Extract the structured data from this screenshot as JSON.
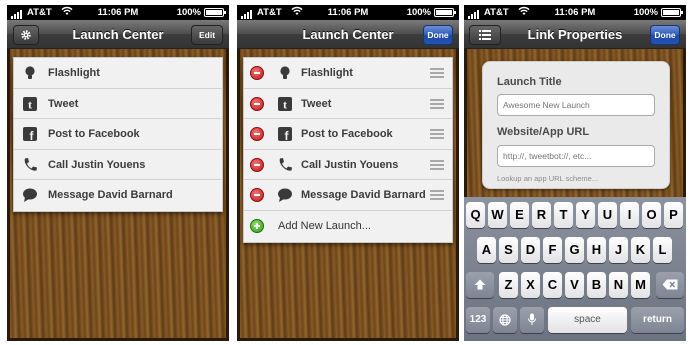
{
  "status": {
    "carrier": "AT&T",
    "time": "11:06 PM",
    "battery": "100%"
  },
  "screen1": {
    "title": "Launch Center",
    "left_button_icon": "gear-icon",
    "right_button": "Edit",
    "items": [
      {
        "label": "Flashlight",
        "icon": "lightbulb-icon"
      },
      {
        "label": "Tweet",
        "icon": "twitter-icon"
      },
      {
        "label": "Post to Facebook",
        "icon": "facebook-icon"
      },
      {
        "label": "Call Justin Youens",
        "icon": "phone-icon"
      },
      {
        "label": "Message David Barnard",
        "icon": "speech-bubble-icon"
      }
    ]
  },
  "screen2": {
    "title": "Launch Center",
    "right_button": "Done",
    "items": [
      {
        "label": "Flashlight",
        "icon": "lightbulb-icon"
      },
      {
        "label": "Tweet",
        "icon": "twitter-icon"
      },
      {
        "label": "Post to Facebook",
        "icon": "facebook-icon"
      },
      {
        "label": "Call Justin Youens",
        "icon": "phone-icon"
      },
      {
        "label": "Message David Barnard",
        "icon": "speech-bubble-icon"
      }
    ],
    "add_label": "Add New Launch..."
  },
  "screen3": {
    "title": "Link Properties",
    "left_button_icon": "list-icon",
    "right_button": "Done",
    "launch_title_label": "Launch Title",
    "launch_title_placeholder": "Awesome New Launch",
    "url_label": "Website/App URL",
    "url_placeholder": "http://, tweetbot://, etc...",
    "hint": "Lookup an app URL scheme...",
    "keyboard": {
      "row1": [
        "Q",
        "W",
        "E",
        "R",
        "T",
        "Y",
        "U",
        "I",
        "O",
        "P"
      ],
      "row2": [
        "A",
        "S",
        "D",
        "F",
        "G",
        "H",
        "J",
        "K",
        "L"
      ],
      "row3": [
        "Z",
        "X",
        "C",
        "V",
        "B",
        "N",
        "M"
      ],
      "numbers_key": "123",
      "space_key": "space",
      "return_key": "return"
    }
  }
}
